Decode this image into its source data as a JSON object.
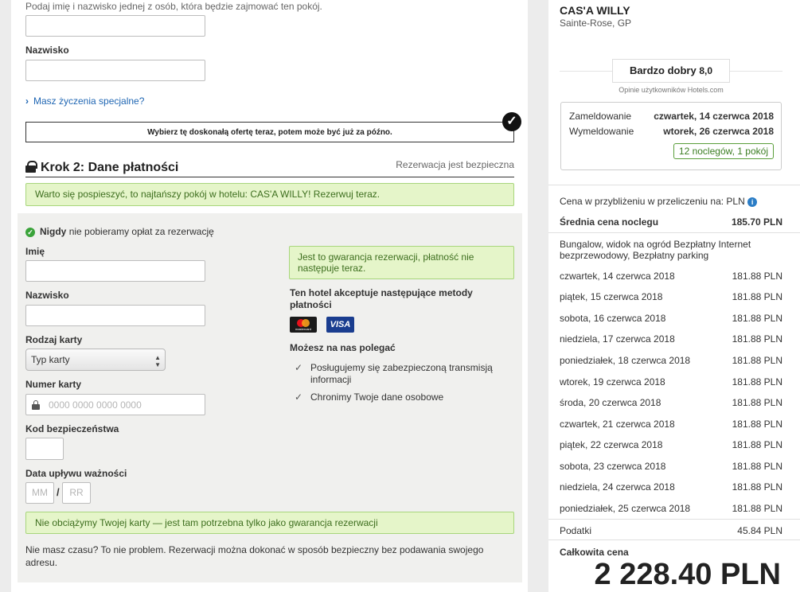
{
  "guest": {
    "hint": "Podaj imię i nazwisko jednej z osób, która będzie zajmować ten pokój.",
    "last_name_label": "Nazwisko",
    "special_requests_link": "Masz życzenia specjalne?"
  },
  "offer_banner": "Wybierz tę doskonałą ofertę teraz, potem może być już za późno.",
  "step2": {
    "title": "Krok 2: Dane płatności",
    "secure_text": "Rezerwacja jest bezpieczna",
    "hurry_note": "Warto się pospieszyć, to najtańszy pokój w hotelu: CAS'A WILLY! Rezerwuj teraz.",
    "never_charge_bold": "Nigdy",
    "never_charge_rest": "nie pobieramy opłat za rezerwację",
    "first_name_label": "Imię",
    "last_name_label": "Nazwisko",
    "card_type_label": "Rodzaj karty",
    "card_type_value": "Typ karty",
    "card_number_label": "Numer karty",
    "card_number_placeholder": "0000 0000 0000 0000",
    "security_code_label": "Kod bezpieczeństwa",
    "expiry_label": "Data upływu ważności",
    "expiry_month_placeholder": "MM",
    "expiry_year_placeholder": "RR",
    "expiry_separator": "/",
    "guarantee_note": "Jest to gwarancja rezerwacji, płatność nie następuje teraz.",
    "methods_title": "Ten hotel akceptuje następujące metody płatności",
    "card_brands": [
      "mastercard",
      "VISA"
    ],
    "trust_title": "Możesz na nas polegać",
    "trust_items": [
      "Posługujemy się zabezpieczoną transmisją informacji",
      "Chronimy Twoje dane osobowe"
    ],
    "no_charge_note": "Nie obciążymy Twojej karty — jest tam potrzebna tylko jako gwarancja rezerwacji",
    "no_time_text": "Nie masz czasu? To nie problem. Rezerwacji można dokonać w sposób bezpieczny bez podawania swojego adresu."
  },
  "sidebar": {
    "hotel_name": "CAS'A WILLY",
    "location": "Sainte-Rose, GP",
    "rating_label": "Bardzo dobry",
    "rating_value": "8,0",
    "rating_source": "Opinie użytkowników Hotels.com",
    "checkin_label": "Zameldowanie",
    "checkin_date": "czwartek, 14 czerwca 2018",
    "checkout_label": "Wymeldowanie",
    "checkout_date": "wtorek, 26 czerwca 2018",
    "nights_badge": "12 noclegów, 1 pokój",
    "currency_note": "Cena w przybliżeniu w przeliczeniu na: PLN",
    "avg_label": "Średnia cena noclegu",
    "avg_value": "185.70 PLN",
    "room_desc": "Bungalow, widok na ogród Bezpłatny Internet bezprzewodowy, Bezpłatny parking",
    "nights": [
      {
        "date": "czwartek, 14 czerwca 2018",
        "price": "181.88 PLN"
      },
      {
        "date": "piątek, 15 czerwca 2018",
        "price": "181.88 PLN"
      },
      {
        "date": "sobota, 16 czerwca 2018",
        "price": "181.88 PLN"
      },
      {
        "date": "niedziela, 17 czerwca 2018",
        "price": "181.88 PLN"
      },
      {
        "date": "poniedziałek, 18 czerwca 2018",
        "price": "181.88 PLN"
      },
      {
        "date": "wtorek, 19 czerwca 2018",
        "price": "181.88 PLN"
      },
      {
        "date": "środa, 20 czerwca 2018",
        "price": "181.88 PLN"
      },
      {
        "date": "czwartek, 21 czerwca 2018",
        "price": "181.88 PLN"
      },
      {
        "date": "piątek, 22 czerwca 2018",
        "price": "181.88 PLN"
      },
      {
        "date": "sobota, 23 czerwca 2018",
        "price": "181.88 PLN"
      },
      {
        "date": "niedziela, 24 czerwca 2018",
        "price": "181.88 PLN"
      },
      {
        "date": "poniedziałek, 25 czerwca 2018",
        "price": "181.88 PLN"
      }
    ],
    "taxes_label": "Podatki",
    "taxes_value": "45.84 PLN",
    "total_label": "Całkowita cena",
    "total_value": "2 228.40 PLN"
  }
}
